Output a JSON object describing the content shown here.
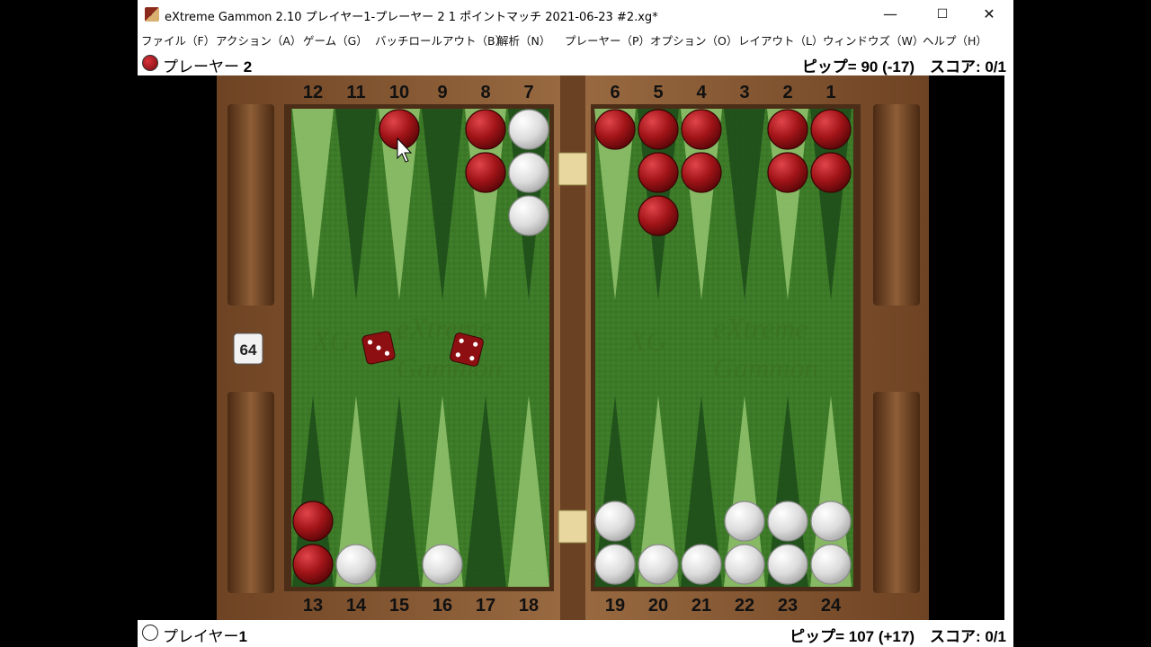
{
  "window": {
    "title": "eXtreme Gammon 2.10 プレイヤー1-プレーヤー 2 1 ポイントマッチ 2021-06-23 #2.xg*",
    "minimize": "—",
    "maximize": "☐",
    "close": "✕"
  },
  "menu": [
    {
      "label": "ファイル（F）"
    },
    {
      "label": "アクション（A）"
    },
    {
      "label": "ゲーム（G）"
    },
    {
      "label": "バッチロールアウト（B）"
    },
    {
      "label": "解析（N）"
    },
    {
      "label": "プレーヤー（P）"
    },
    {
      "label": "オプション（O）"
    },
    {
      "label": "レイアウト（L）"
    },
    {
      "label": "ウィンドウズ（W）"
    },
    {
      "label": "ヘルプ（H）"
    }
  ],
  "top_player": {
    "name": "プレーヤー",
    "number": "2",
    "pips": "ピップ= 90 (-17)",
    "score": "スコア: 0/1",
    "checker_color": "#8e0f12"
  },
  "bottom_player": {
    "name": "プレイヤー",
    "number": "1",
    "pips": "ピップ= 107 (+17)",
    "score": "スコア: 0/1",
    "checker_color": "#ffffff"
  },
  "board": {
    "top_labels": [
      "12",
      "11",
      "10",
      "9",
      "8",
      "7",
      "6",
      "5",
      "4",
      "3",
      "2",
      "1"
    ],
    "bottom_labels": [
      "13",
      "14",
      "15",
      "16",
      "17",
      "18",
      "19",
      "20",
      "21",
      "22",
      "23",
      "24"
    ],
    "cube_value": "64",
    "dice": [
      3,
      4
    ],
    "watermark": [
      "eXtreme",
      "Gammon"
    ],
    "logo": "XG",
    "colors": {
      "felt": "#3f7d2a",
      "point_light": "#8fc06a",
      "point_dark": "#1f4e1a",
      "wood": "#8a5a36",
      "red_checker": "#8e0f12",
      "white_checker": "#e6e6e6"
    },
    "checkers": [
      {
        "point": 10,
        "color": "red",
        "count": 1
      },
      {
        "point": 8,
        "color": "red",
        "count": 2
      },
      {
        "point": 7,
        "color": "white",
        "count": 3
      },
      {
        "point": 6,
        "color": "red",
        "count": 1
      },
      {
        "point": 5,
        "color": "red",
        "count": 3
      },
      {
        "point": 4,
        "color": "red",
        "count": 2
      },
      {
        "point": 2,
        "color": "red",
        "count": 2
      },
      {
        "point": 1,
        "color": "red",
        "count": 2
      },
      {
        "point": 13,
        "color": "red",
        "count": 2
      },
      {
        "point": 14,
        "color": "white",
        "count": 1
      },
      {
        "point": 16,
        "color": "white",
        "count": 1
      },
      {
        "point": 19,
        "color": "white",
        "count": 2
      },
      {
        "point": 20,
        "color": "white",
        "count": 1
      },
      {
        "point": 21,
        "color": "white",
        "count": 1
      },
      {
        "point": 22,
        "color": "white",
        "count": 2
      },
      {
        "point": 23,
        "color": "white",
        "count": 2
      },
      {
        "point": 24,
        "color": "white",
        "count": 2
      }
    ]
  }
}
